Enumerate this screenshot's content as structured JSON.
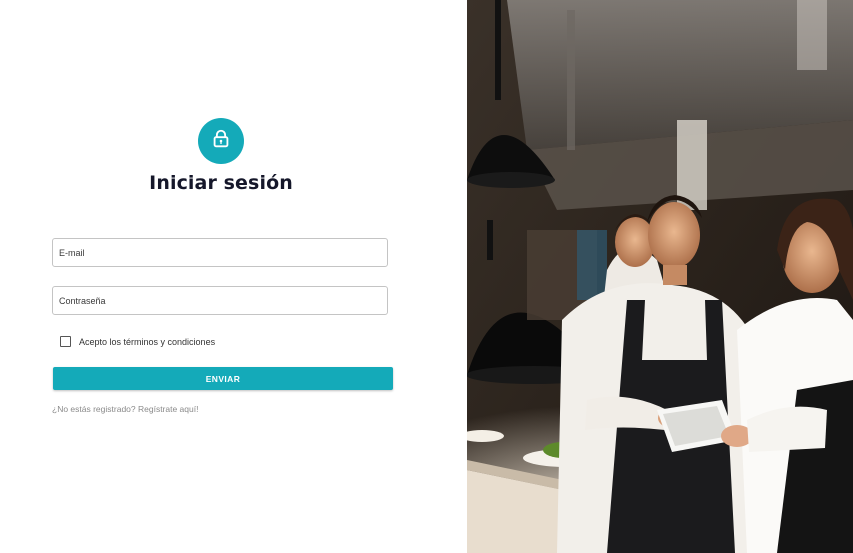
{
  "login": {
    "title": "Iniciar sesión",
    "icon": "lock-icon",
    "email_placeholder": "E-mail",
    "password_placeholder": "Contraseña",
    "terms_label": "Acepto los términos y condiciones",
    "terms_checked": false,
    "submit_label": "ENVIAR",
    "register_link": "¿No estás registrado? Regístrate aquí!"
  },
  "photo": {
    "subject": "restaurant-staff-kitchen-photo"
  },
  "colors": {
    "accent": "#14aab9",
    "title": "#15172a",
    "link": "#8a8a8a"
  }
}
